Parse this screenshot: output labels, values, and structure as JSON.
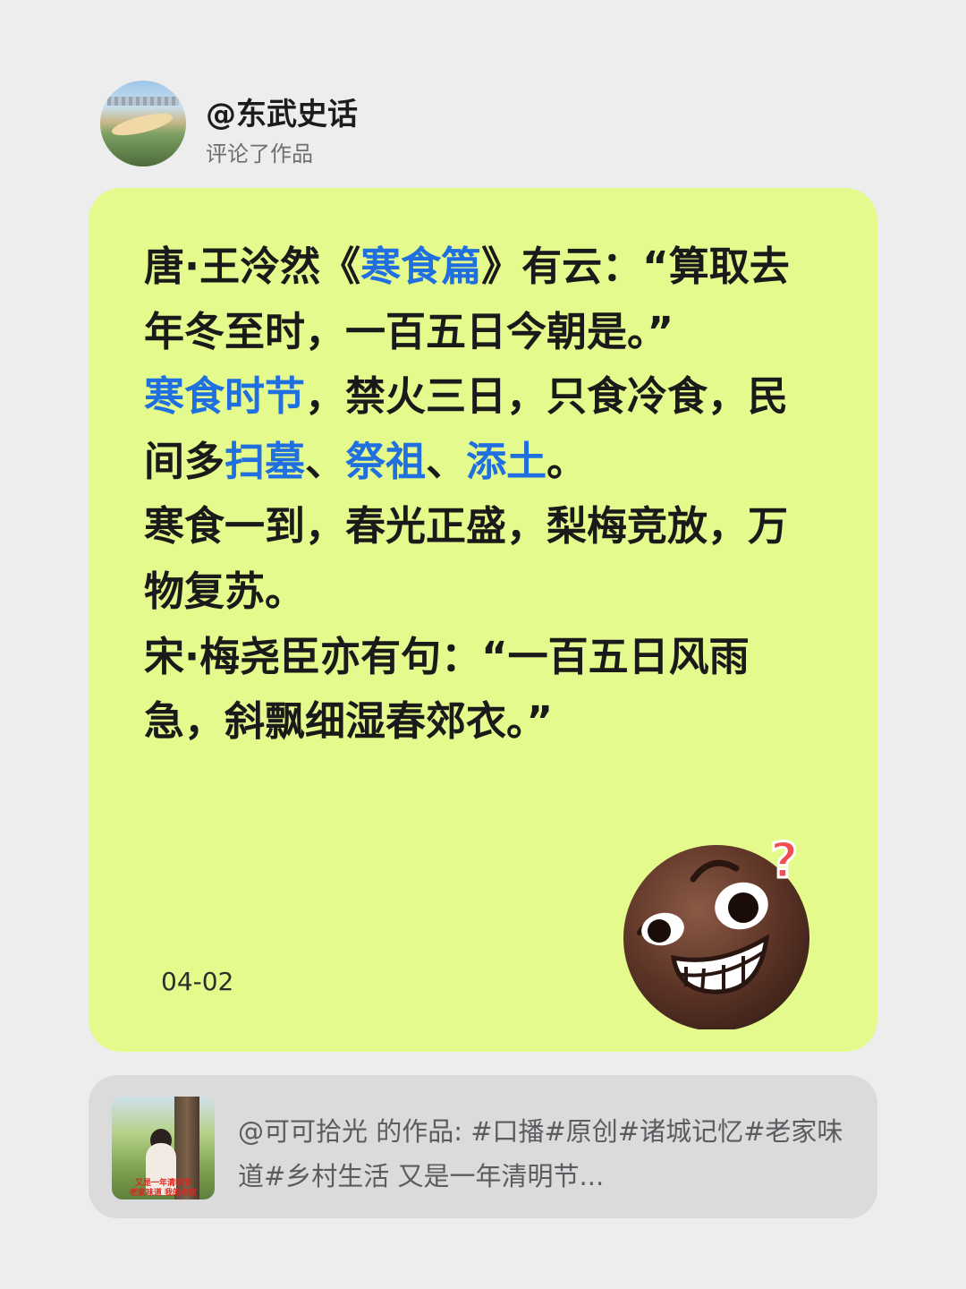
{
  "header": {
    "username": "@东武史话",
    "action": "评论了作品"
  },
  "comment": {
    "segments": [
      {
        "text": "唐·王泠然《",
        "hl": false
      },
      {
        "text": "寒食篇",
        "hl": true
      },
      {
        "text": "》有云：“算取去年冬至时，一百五日今朝是。”",
        "hl": false
      },
      {
        "br": true
      },
      {
        "text": "寒食时节",
        "hl": true
      },
      {
        "text": "，禁火三日，只食冷食，民间多",
        "hl": false
      },
      {
        "text": "扫墓",
        "hl": true
      },
      {
        "text": "、",
        "hl": false
      },
      {
        "text": "祭祖",
        "hl": true
      },
      {
        "text": "、",
        "hl": false
      },
      {
        "text": "添土",
        "hl": true
      },
      {
        "text": "。",
        "hl": false
      },
      {
        "br": true
      },
      {
        "text": "寒食一到，春光正盛，梨梅竞放，万物复苏。",
        "hl": false
      },
      {
        "br": true
      },
      {
        "text": "宋·梅尧臣亦有句：“一百五日风雨急，斜飘细湿春郊衣。”",
        "hl": false
      }
    ],
    "date": "04-02",
    "emoji": "grinning-confused-face-emoji",
    "highlight_color": "#1f6fe0",
    "card_color": "#e4fa8c"
  },
  "reference": {
    "thumbnail_caption": "又是一年清明节\n老家味道  我的老家",
    "text": "@可可拾光 的作品: #口播#原创#诸城记忆#老家味道#乡村生活 又是一年清明节..."
  }
}
